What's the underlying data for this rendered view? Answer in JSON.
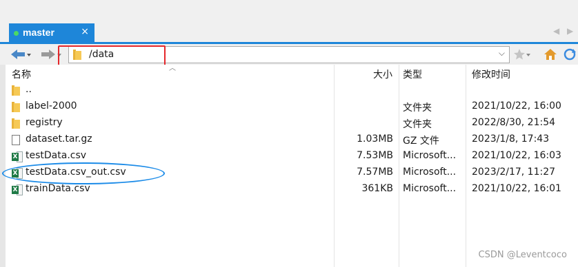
{
  "tab": {
    "title": "master",
    "close_icon": "×"
  },
  "tab_nav": {
    "prev": "◀",
    "next": "▶"
  },
  "nav": {
    "path": "/data"
  },
  "columns": {
    "name": "名称",
    "size": "大小",
    "type": "类型",
    "modified": "修改时间"
  },
  "files": [
    {
      "name": "..",
      "size": "",
      "type": "",
      "modified": "",
      "icon": "folder-icon"
    },
    {
      "name": "label-2000",
      "size": "",
      "type": "文件夹",
      "modified": "2021/10/22, 16:00",
      "icon": "folder-icon"
    },
    {
      "name": "registry",
      "size": "",
      "type": "文件夹",
      "modified": "2022/8/30, 21:54",
      "icon": "folder-icon"
    },
    {
      "name": "dataset.tar.gz",
      "size": "1.03MB",
      "type": "GZ 文件",
      "modified": "2023/1/8, 17:43",
      "icon": "file-icon"
    },
    {
      "name": "testData.csv",
      "size": "7.53MB",
      "type": "Microsoft...",
      "modified": "2021/10/22, 16:03",
      "icon": "excel-icon"
    },
    {
      "name": "testData.csv_out.csv",
      "size": "7.57MB",
      "type": "Microsoft...",
      "modified": "2023/2/17, 11:27",
      "icon": "excel-icon"
    },
    {
      "name": "trainData.csv",
      "size": "361KB",
      "type": "Microsoft...",
      "modified": "2021/10/22, 16:01",
      "icon": "excel-icon"
    }
  ],
  "watermark": "CSDN @Leventcoco",
  "colors": {
    "tab": "#1e86d9",
    "highlight_box": "#e5262a",
    "highlight_ellipse": "#1b8be8"
  }
}
